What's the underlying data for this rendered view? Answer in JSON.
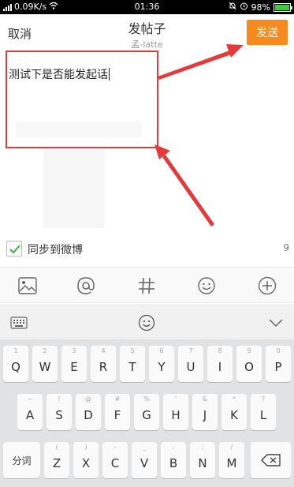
{
  "status_bar": {
    "network_speed": "0.09K/s",
    "time": "01:36",
    "battery_percent": "98%"
  },
  "header": {
    "cancel_label": "取消",
    "title": "发帖子",
    "subtitle": "孟-latte",
    "send_label": "发送"
  },
  "compose": {
    "text": "测试下是否能发起话"
  },
  "sync": {
    "label": "同步到微博",
    "checked": true,
    "remaining_count": "9"
  },
  "attachments": {
    "tools": [
      "image-icon",
      "mention-icon",
      "hashtag-icon",
      "emoji-icon",
      "add-icon"
    ]
  },
  "keyboard": {
    "toolbar": [
      "keyboard-icon",
      "emoji-icon",
      "collapse-icon"
    ],
    "row1": [
      {
        "key": "Q",
        "alt": "1"
      },
      {
        "key": "W",
        "alt": "2"
      },
      {
        "key": "E",
        "alt": "3"
      },
      {
        "key": "R",
        "alt": "4"
      },
      {
        "key": "T",
        "alt": "5"
      },
      {
        "key": "Y",
        "alt": "6"
      },
      {
        "key": "U",
        "alt": "7"
      },
      {
        "key": "I",
        "alt": "8"
      },
      {
        "key": "O",
        "alt": "9"
      },
      {
        "key": "P",
        "alt": "0"
      }
    ],
    "row2": [
      {
        "key": "A",
        "alt": "~"
      },
      {
        "key": "S",
        "alt": "!"
      },
      {
        "key": "D",
        "alt": "@"
      },
      {
        "key": "F",
        "alt": "#"
      },
      {
        "key": "G",
        "alt": "%"
      },
      {
        "key": "H",
        "alt": "'"
      },
      {
        "key": "J",
        "alt": "&"
      },
      {
        "key": "K",
        "alt": "*"
      },
      {
        "key": "L",
        "alt": "?"
      }
    ],
    "row3": [
      {
        "key": "Z",
        "alt": "("
      },
      {
        "key": "X",
        "alt": ")"
      },
      {
        "key": "C",
        "alt": "-"
      },
      {
        "key": "V",
        "alt": "_"
      },
      {
        "key": "B",
        "alt": ":"
      },
      {
        "key": "N",
        "alt": ";"
      },
      {
        "key": "M",
        "alt": "/"
      }
    ],
    "segment_label": "分词"
  },
  "colors": {
    "accent": "#f78a1e",
    "annotation": "#e23b3b",
    "check": "#3cb043"
  }
}
